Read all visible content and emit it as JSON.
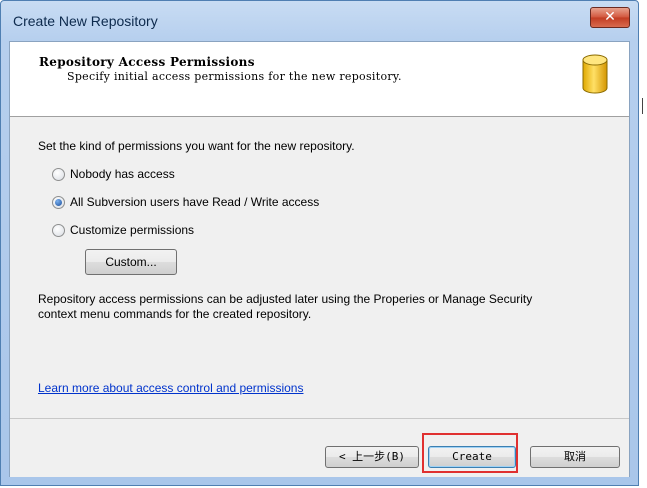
{
  "window": {
    "title": "Create New Repository",
    "close_label": "✕"
  },
  "header": {
    "title": "Repository Access Permissions",
    "subtitle": "Specify initial access permissions for the new repository.",
    "icon": "database-icon"
  },
  "body": {
    "prompt": "Set the kind of permissions you want for the new repository.",
    "options": [
      {
        "label": "Nobody has access",
        "selected": false
      },
      {
        "label": "All Subversion users have Read / Write access",
        "selected": true
      },
      {
        "label": "Customize permissions",
        "selected": false
      }
    ],
    "custom_button_label": "Custom...",
    "note_line1": "Repository access permissions can be adjusted later using the Properies or Manage Security",
    "note_line2": "context menu commands for the created repository.",
    "learn_more_link": "Learn more about access control and permissions"
  },
  "footer": {
    "back_label": "< 上一步(B)",
    "create_label": "Create",
    "cancel_label": "取消"
  },
  "colors": {
    "title_gradient": "#b6cfee",
    "link": "#0033cc",
    "highlight": "#e03030",
    "db_icon": "#f2c200"
  }
}
